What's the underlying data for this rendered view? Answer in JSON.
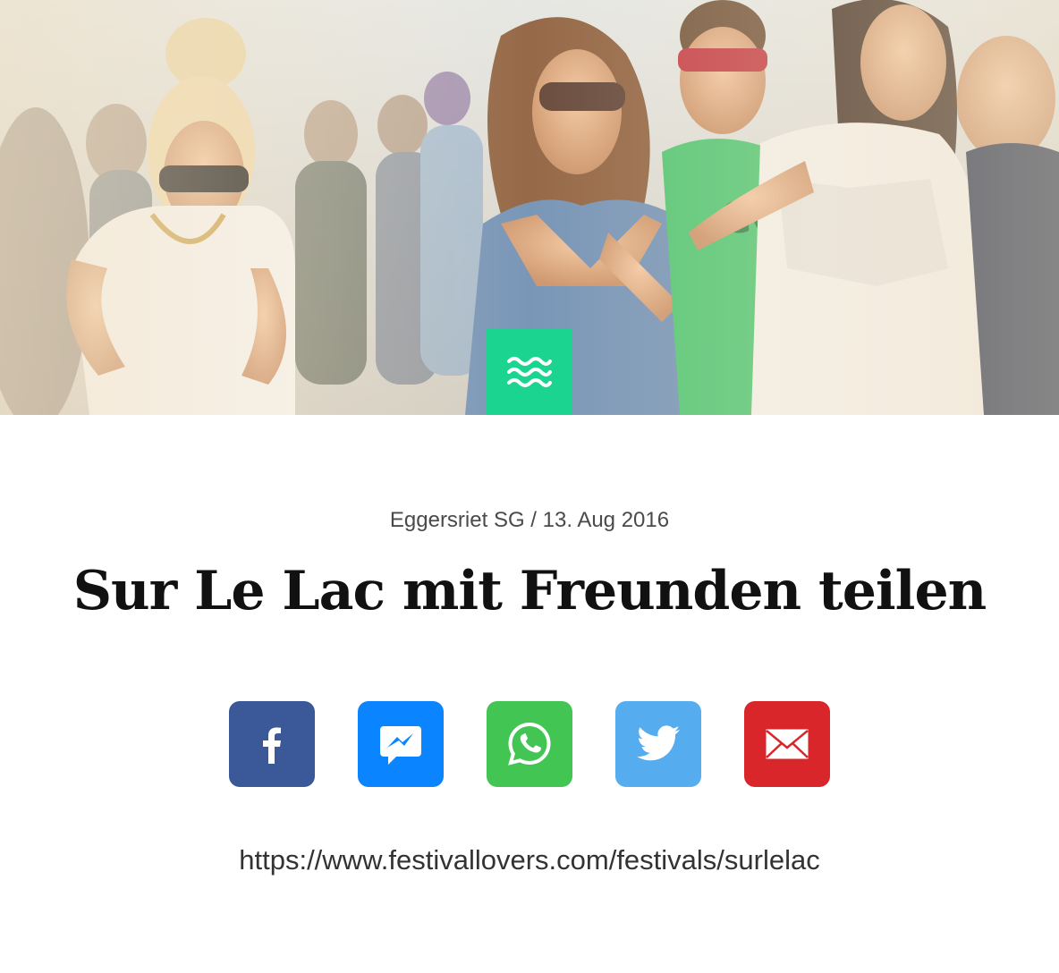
{
  "hero": {
    "photo": "festival-crowd-photo",
    "badge_icon": "waves-icon",
    "badge_color": "#1ad48f"
  },
  "event": {
    "meta": "Eggersriet SG / 13. Aug 2016",
    "title": "Sur Le Lac mit Freunden teilen"
  },
  "share": {
    "buttons": [
      {
        "icon": "facebook-icon",
        "color": "#3b5998"
      },
      {
        "icon": "messenger-icon",
        "color": "#0a84ff"
      },
      {
        "icon": "whatsapp-icon",
        "color": "#43c553"
      },
      {
        "icon": "twitter-icon",
        "color": "#55acee"
      },
      {
        "icon": "email-icon",
        "color": "#d9262b"
      }
    ]
  },
  "url": "https://www.festivallovers.com/festivals/surlelac"
}
